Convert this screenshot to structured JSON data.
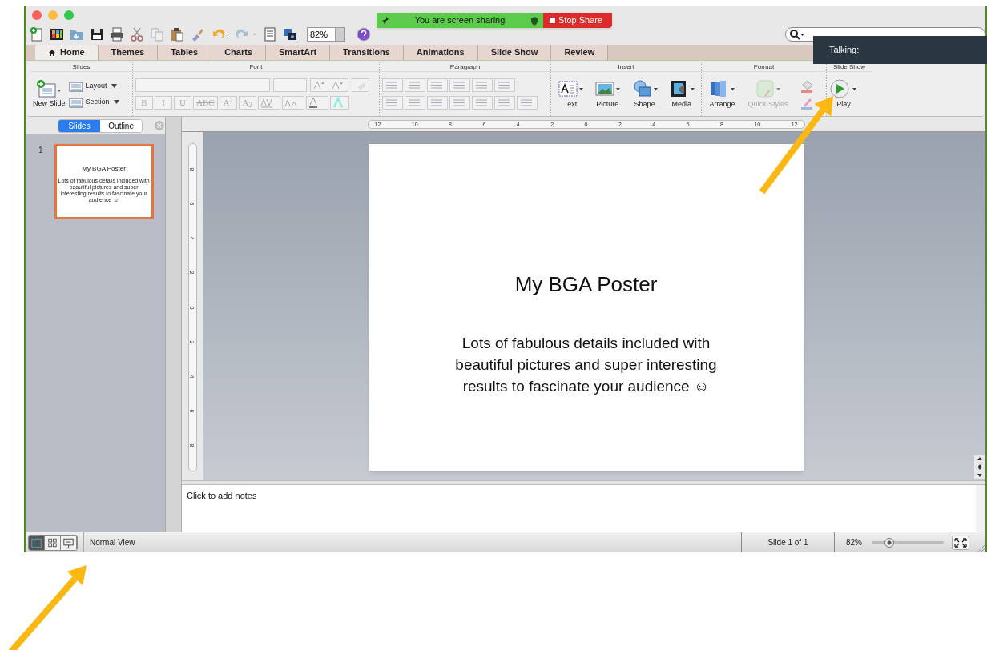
{
  "share_banner": {
    "status": "You are screen sharing",
    "stop": "Stop Share"
  },
  "toolbar": {
    "zoom": "82%"
  },
  "talking": "Talking:",
  "tabs": [
    {
      "label": "Home",
      "selected": true
    },
    {
      "label": "Themes",
      "selected": false
    },
    {
      "label": "Tables",
      "selected": false
    },
    {
      "label": "Charts",
      "selected": false
    },
    {
      "label": "SmartArt",
      "selected": false
    },
    {
      "label": "Transitions",
      "selected": false
    },
    {
      "label": "Animations",
      "selected": false
    },
    {
      "label": "Slide Show",
      "selected": false
    },
    {
      "label": "Review",
      "selected": false
    }
  ],
  "ribbon": {
    "slides": {
      "title": "Slides",
      "new_slide": "New Slide",
      "layout": "Layout",
      "section": "Section"
    },
    "font": {
      "title": "Font",
      "buttons": [
        "B",
        "I",
        "U",
        "ABC",
        "A$^{2}$",
        "A$_{2}$"
      ]
    },
    "paragraph": {
      "title": "Paragraph"
    },
    "insert": {
      "title": "Insert",
      "items": [
        {
          "label": "Text",
          "disabled": false
        },
        {
          "label": "Picture",
          "disabled": false
        },
        {
          "label": "Shape",
          "disabled": false
        },
        {
          "label": "Media",
          "disabled": false
        }
      ]
    },
    "format": {
      "title": "Format",
      "items": [
        {
          "label": "Arrange",
          "disabled": false
        },
        {
          "label": "Quick Styles",
          "disabled": true
        }
      ]
    },
    "slide_show": {
      "title": "Slide Show",
      "play": "Play"
    }
  },
  "pane_tabs": [
    {
      "label": "Slides",
      "selected": true
    },
    {
      "label": "Outline",
      "selected": false
    }
  ],
  "thumbnails": [
    {
      "number": "1",
      "selected": true,
      "title": "My BGA Poster",
      "body": "Lots of fabulous details included with beautiful pictures and super interesting results to fascinate your audience ☺"
    }
  ],
  "ruler_h": [
    "12",
    "10",
    "8",
    "6",
    "4",
    "2",
    "0",
    "2",
    "4",
    "6",
    "8",
    "10",
    "12"
  ],
  "ruler_v": [
    "8",
    "6",
    "4",
    "2",
    "0",
    "2",
    "4",
    "6",
    "8"
  ],
  "slide": {
    "title": "My BGA Poster",
    "body_lines": [
      "Lots of fabulous details included with",
      "beautiful pictures and super interesting",
      "results to fascinate your audience ☺"
    ]
  },
  "notes": {
    "placeholder": "Click to add notes"
  },
  "status_bar": {
    "views": [
      {
        "kind": "normal",
        "selected": true
      },
      {
        "kind": "sorter",
        "selected": false
      },
      {
        "kind": "show",
        "selected": false
      }
    ],
    "view_name": "Normal View",
    "slide_count": "Slide 1 of 1",
    "zoom": "82%",
    "zoom_level": {
      "level": 0.2
    }
  }
}
